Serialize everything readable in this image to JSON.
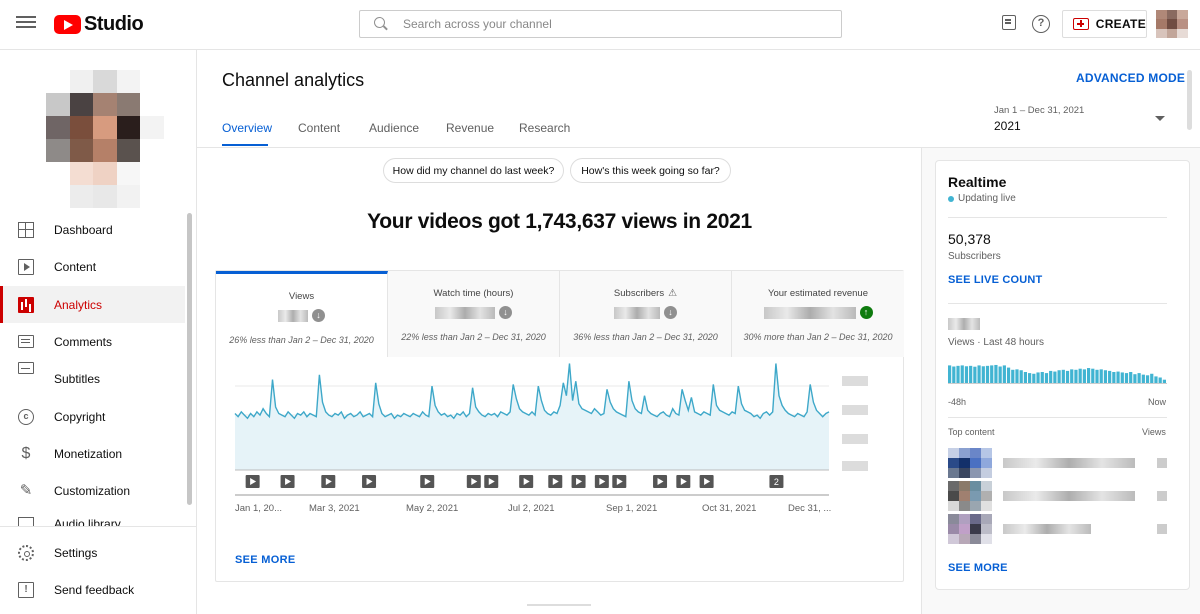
{
  "topbar": {
    "logo_text": "Studio",
    "search_placeholder": "Search across your channel",
    "help_glyph": "?",
    "create_label": "CREATE"
  },
  "sidebar": {
    "items": [
      {
        "label": "Dashboard",
        "icon": "dashboard-icon"
      },
      {
        "label": "Content",
        "icon": "content-icon"
      },
      {
        "label": "Analytics",
        "icon": "analytics-icon",
        "active": true
      },
      {
        "label": "Comments",
        "icon": "comments-icon"
      },
      {
        "label": "Subtitles",
        "icon": "subtitles-icon"
      },
      {
        "label": "Copyright",
        "icon": "copyright-icon"
      },
      {
        "label": "Monetization",
        "icon": "monetization-icon"
      },
      {
        "label": "Customization",
        "icon": "customization-icon"
      },
      {
        "label": "Audio library",
        "icon": "audio-library-icon"
      }
    ],
    "bottom": [
      {
        "label": "Settings",
        "icon": "settings-icon"
      },
      {
        "label": "Send feedback",
        "icon": "send-feedback-icon"
      }
    ],
    "copyright_glyph": "c",
    "money_glyph": "$",
    "custom_glyph": "✎",
    "feedback_glyph": "!"
  },
  "header": {
    "title": "Channel analytics",
    "advanced_mode": "ADVANCED MODE",
    "tabs": [
      "Overview",
      "Content",
      "Audience",
      "Revenue",
      "Research"
    ],
    "date_range": "Jan 1 – Dec 31, 2021",
    "date_year": "2021"
  },
  "overview": {
    "chips": [
      "How did my channel do last week?",
      "How's this week going so far?"
    ],
    "headline": "Your videos got 1,743,637 views in 2021",
    "metrics": [
      {
        "label": "Views",
        "compare": "26% less than Jan 2 – Dec 31, 2020",
        "trend": "down",
        "glyph": "↓"
      },
      {
        "label": "Watch time (hours)",
        "compare": "22% less than Jan 2 – Dec 31, 2020",
        "trend": "down",
        "glyph": "↓"
      },
      {
        "label": "Subscribers",
        "compare": "36% less than Jan 2 – Dec 31, 2020",
        "trend": "down",
        "glyph": "↓",
        "warning": "⚠"
      },
      {
        "label": "Your estimated revenue",
        "compare": "30% more than Jan 2 – Dec 31, 2020",
        "trend": "up",
        "glyph": "↑"
      }
    ],
    "see_more": "SEE MORE"
  },
  "chart_data": {
    "type": "area",
    "x_tick_labels": [
      "Jan 1, 20...",
      "Mar 3, 2021",
      "May 2, 2021",
      "Jul 2, 2021",
      "Sep 1, 2021",
      "Oct 31, 2021",
      "Dec 31, ..."
    ],
    "values": [
      3.5,
      3.3,
      3.6,
      3.4,
      3.2,
      3.5,
      3.3,
      3.6,
      3.4,
      3.8,
      3.5,
      3.3,
      5.6,
      3.9,
      3.5,
      3.4,
      3.3,
      3.6,
      3.4,
      3.2,
      3.5,
      3.4,
      3.6,
      3.3,
      3.5,
      3.4,
      3.3,
      5.9,
      4.2,
      3.6,
      3.4,
      3.3,
      3.5,
      3.4,
      3.6,
      3.2,
      3.4,
      3.5,
      3.3,
      3.4,
      3.6,
      3.3,
      3.4,
      3.5,
      3.3,
      5.4,
      4.1,
      3.5,
      3.3,
      3.4,
      3.5,
      3.2,
      3.4,
      3.3,
      3.5,
      3.4,
      3.3,
      3.5,
      3.4,
      3.3,
      3.6,
      3.4,
      3.3,
      5.2,
      4.0,
      3.6,
      3.4,
      3.5,
      3.3,
      3.4,
      3.2,
      3.5,
      3.4,
      3.6,
      3.3,
      3.5,
      5.1,
      3.9,
      3.6,
      3.4,
      3.3,
      3.5,
      3.4,
      3.5,
      3.3,
      3.6,
      3.5,
      3.4,
      3.6,
      5.3,
      4.4,
      3.8,
      3.6,
      3.5,
      3.4,
      3.6,
      3.4,
      5.2,
      4.3,
      3.7,
      3.5,
      3.4,
      3.6,
      3.5,
      4.0,
      5.4,
      4.6,
      6.6,
      4.3,
      5.5,
      4.1,
      3.8,
      3.7,
      3.6,
      3.5,
      3.8,
      3.6,
      3.4,
      3.5,
      5.0,
      4.2,
      3.8,
      3.6,
      3.5,
      3.4,
      3.3,
      5.5,
      4.3,
      3.8,
      3.6,
      3.5,
      4.6,
      3.7,
      3.5,
      3.4,
      3.3,
      3.5,
      3.6,
      3.4,
      3.3,
      3.8,
      3.5,
      3.4,
      5.0,
      4.3,
      3.7,
      4.5,
      3.6,
      3.5,
      3.4,
      3.6,
      3.5,
      3.4,
      5.3,
      4.0,
      3.7,
      3.6,
      3.5,
      3.4,
      3.6,
      3.5,
      5.2,
      4.1,
      3.7,
      3.6,
      3.5,
      3.3,
      3.4,
      3.2,
      3.5,
      3.6,
      3.4,
      3.6,
      6.6,
      4.6,
      4.0,
      3.7,
      3.5,
      3.4,
      3.3,
      3.5,
      3.4,
      3.3,
      3.6,
      5.3,
      4.2,
      3.7,
      3.5,
      3.3,
      3.5,
      3.6
    ],
    "ylim": [
      0,
      7
    ],
    "grid": true,
    "video_markers": [
      {
        "x": 0.02,
        "label": ""
      },
      {
        "x": 0.08,
        "label": ""
      },
      {
        "x": 0.15,
        "label": ""
      },
      {
        "x": 0.22,
        "label": ""
      },
      {
        "x": 0.32,
        "label": ""
      },
      {
        "x": 0.4,
        "label": ""
      },
      {
        "x": 0.43,
        "label": ""
      },
      {
        "x": 0.49,
        "label": ""
      },
      {
        "x": 0.54,
        "label": ""
      },
      {
        "x": 0.58,
        "label": ""
      },
      {
        "x": 0.62,
        "label": ""
      },
      {
        "x": 0.65,
        "label": ""
      },
      {
        "x": 0.72,
        "label": ""
      },
      {
        "x": 0.76,
        "label": ""
      },
      {
        "x": 0.8,
        "label": ""
      },
      {
        "x": 0.92,
        "label": "2"
      }
    ]
  },
  "realtime": {
    "title": "Realtime",
    "live": "Updating live",
    "subscribers_value": "50,378",
    "subscribers_label": "Subscribers",
    "live_count": "SEE LIVE COUNT",
    "views_label": "Views · Last 48 hours",
    "axis_left": "-48h",
    "axis_right": "Now",
    "top_content": "Top content",
    "views_col": "Views",
    "bars": [
      0.8,
      0.75,
      0.78,
      0.8,
      0.76,
      0.78,
      0.74,
      0.8,
      0.76,
      0.78,
      0.8,
      0.82,
      0.75,
      0.8,
      0.7,
      0.6,
      0.62,
      0.58,
      0.5,
      0.45,
      0.42,
      0.48,
      0.5,
      0.45,
      0.55,
      0.52,
      0.58,
      0.6,
      0.55,
      0.62,
      0.6,
      0.65,
      0.62,
      0.68,
      0.65,
      0.6,
      0.62,
      0.58,
      0.55,
      0.5,
      0.52,
      0.48,
      0.45,
      0.5,
      0.4,
      0.45,
      0.38,
      0.35,
      0.42,
      0.3,
      0.25,
      0.15
    ],
    "see_more": "SEE MORE"
  },
  "colors": {
    "accent_blue": "#065fd4",
    "analytics_red": "#cc0000",
    "chart_line": "#3ea8c9",
    "chart_fill": "#e6f3f8",
    "realtime_bar": "#41b4d2",
    "trend_up": "#0f7b0f"
  }
}
